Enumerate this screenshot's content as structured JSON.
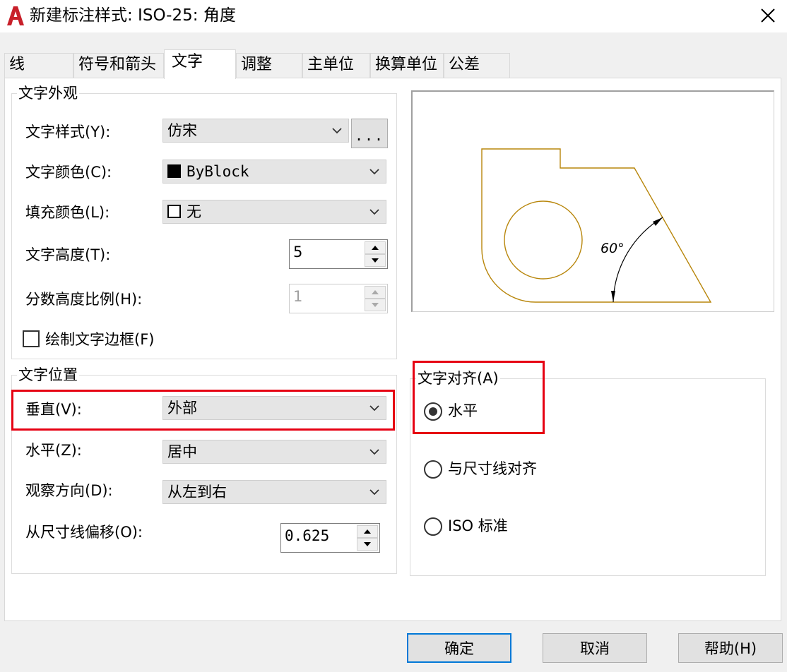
{
  "window": {
    "title": "新建标注样式: ISO-25: 角度",
    "app_icon": "autocad-icon",
    "close_icon": "close-icon"
  },
  "tabs": [
    {
      "label": "线",
      "active": false
    },
    {
      "label": "符号和箭头",
      "active": false
    },
    {
      "label": "文字",
      "active": true
    },
    {
      "label": "调整",
      "active": false
    },
    {
      "label": "主单位",
      "active": false
    },
    {
      "label": "换算单位",
      "active": false
    },
    {
      "label": "公差",
      "active": false
    }
  ],
  "appearance": {
    "title": "文字外观",
    "text_style": {
      "label": "文字样式(Y):",
      "value": "仿宋",
      "browse_label": "..."
    },
    "text_color": {
      "label": "文字颜色(C):",
      "value": "ByBlock",
      "swatch": "#000000"
    },
    "fill_color": {
      "label": "填充颜色(L):",
      "value": "无",
      "swatch": "#ffffff"
    },
    "text_height": {
      "label": "文字高度(T):",
      "value": "5"
    },
    "fraction_scale": {
      "label": "分数高度比例(H):",
      "value": "1",
      "disabled": true
    },
    "draw_frame": {
      "label": "绘制文字边框(F)",
      "checked": false
    }
  },
  "placement": {
    "title": "文字位置",
    "vertical": {
      "label": "垂直(V):",
      "value": "外部"
    },
    "horizontal": {
      "label": "水平(Z):",
      "value": "居中"
    },
    "view_direction": {
      "label": "观察方向(D):",
      "value": "从左到右"
    },
    "offset": {
      "label": "从尺寸线偏移(O):",
      "value": "0.625"
    }
  },
  "preview": {
    "angle_text": "60°",
    "line_color": "#b8860b"
  },
  "alignment": {
    "title": "文字对齐(A)",
    "options": [
      {
        "label": "水平",
        "selected": true
      },
      {
        "label": "与尺寸线对齐",
        "selected": false
      },
      {
        "label": "ISO 标准",
        "selected": false
      }
    ]
  },
  "footer": {
    "ok_label": "确定",
    "cancel_label": "取消",
    "help_label": "帮助(H)"
  },
  "highlight_color": "#e60012"
}
